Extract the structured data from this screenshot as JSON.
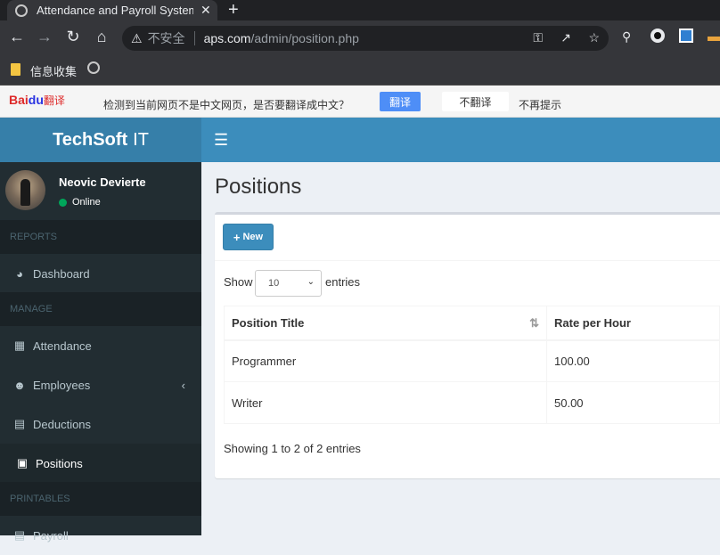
{
  "browser": {
    "tab_title": "Attendance and Payroll System",
    "close_glyph": "✕",
    "new_tab_glyph": "+",
    "security_label": "不安全",
    "url_domain": "aps.com",
    "url_path": "/admin/position.php",
    "bookmark_label": "信息收集"
  },
  "translate_bar": {
    "brand_bai": "Bai",
    "brand_du": "du",
    "brand_fy": "翻译",
    "message": "检测到当前网页不是中文网页，是否要翻译成中文？",
    "translate_btn": "翻译",
    "no_translate_btn": "不翻译",
    "no_prompt": "不再提示"
  },
  "sidebar": {
    "logo_bold": "TechSoft",
    "logo_light": "IT",
    "user_name": "Neovic Devierte",
    "user_status": "Online",
    "sections": {
      "reports": "REPORTS",
      "manage": "MANAGE",
      "printables": "PRINTABLES"
    },
    "items": {
      "dashboard": "Dashboard",
      "attendance": "Attendance",
      "employees": "Employees",
      "deductions": "Deductions",
      "positions": "Positions",
      "payroll": "Payroll"
    }
  },
  "main": {
    "page_title": "Positions",
    "new_button": "New",
    "show_label": "Show",
    "entries_select": "10",
    "entries_label": "entries",
    "table": {
      "columns": [
        "Position Title",
        "Rate per Hour"
      ],
      "rows": [
        [
          "Programmer",
          "100.00"
        ],
        [
          "Writer",
          "50.00"
        ]
      ]
    },
    "info": "Showing 1 to 2 of 2 entries"
  },
  "colors": {
    "header_blue": "#3c8dbc",
    "logo_blue": "#367fa9",
    "sidebar_bg": "#222d32",
    "online_green": "#00a65a"
  },
  "icons": [
    "globe-icon",
    "back-icon",
    "forward-icon",
    "reload-icon",
    "home-icon",
    "warning-icon",
    "key-icon",
    "share-icon",
    "star-icon",
    "search-icon",
    "extension-icon",
    "bookmark-folder-icon",
    "hamburger-icon",
    "dashboard-icon",
    "calendar-icon",
    "users-icon",
    "file-icon",
    "briefcase-icon",
    "plus-icon",
    "sort-icon"
  ]
}
